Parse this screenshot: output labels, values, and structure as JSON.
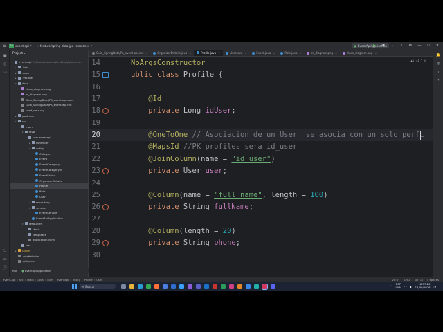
{
  "titlebar": {
    "project_badge": "EA",
    "project_name": "event-api",
    "branch": "feature/spring-data-jpa-relaciones",
    "run_config": "EventApiApplication"
  },
  "project_panel": {
    "title": "Project",
    "tree": [
      {
        "label": "event-api",
        "suffix": "C:\\Users\\Usuario\\Desktop\\Aplicacion",
        "depth": 0,
        "kind": "folder",
        "expanded": true
      },
      {
        "label": ".idea",
        "depth": 1,
        "kind": "folder"
      },
      {
        "label": ".mvn",
        "depth": 1,
        "kind": "folder"
      },
      {
        "label": ".vscode",
        "depth": 1,
        "kind": "folder"
      },
      {
        "label": "docs",
        "depth": 1,
        "kind": "folder",
        "expanded": true
      },
      {
        "label": "class_diagram.png",
        "depth": 2,
        "kind": "image"
      },
      {
        "label": "er_diagram.png",
        "depth": 2,
        "kind": "image"
      },
      {
        "label": "Guia_SpringDataJPA_event-api.docx",
        "depth": 2,
        "kind": "doc"
      },
      {
        "label": "Guia_SpringDataJPA_event-api.md",
        "depth": 2,
        "kind": "doc"
      },
      {
        "label": "seed_data.sql",
        "depth": 2,
        "kind": "doc"
      },
      {
        "label": "postman",
        "depth": 1,
        "kind": "folder"
      },
      {
        "label": "src",
        "depth": 1,
        "kind": "folder",
        "expanded": true
      },
      {
        "label": "main",
        "depth": 2,
        "kind": "folder",
        "expanded": true
      },
      {
        "label": "java",
        "depth": 3,
        "kind": "folder",
        "expanded": true
      },
      {
        "label": "com.eventapi",
        "depth": 4,
        "kind": "package",
        "expanded": true
      },
      {
        "label": "controller",
        "depth": 5,
        "kind": "package"
      },
      {
        "label": "entity",
        "depth": 5,
        "kind": "package",
        "expanded": true
      },
      {
        "label": "Category",
        "depth": 6,
        "kind": "class"
      },
      {
        "label": "Event",
        "depth": 6,
        "kind": "class"
      },
      {
        "label": "EventCategory",
        "depth": 6,
        "kind": "class"
      },
      {
        "label": "EventCategoryId",
        "depth": 6,
        "kind": "class"
      },
      {
        "label": "EventStatus",
        "depth": 6,
        "kind": "class"
      },
      {
        "label": "OrganizerDetails",
        "depth": 6,
        "kind": "class"
      },
      {
        "label": "Profile",
        "depth": 6,
        "kind": "class",
        "selected": true
      },
      {
        "label": "Role",
        "depth": 6,
        "kind": "class"
      },
      {
        "label": "User",
        "depth": 6,
        "kind": "class"
      },
      {
        "label": "repository",
        "depth": 5,
        "kind": "package"
      },
      {
        "label": "service",
        "depth": 5,
        "kind": "package",
        "expanded": true
      },
      {
        "label": "EventService",
        "depth": 6,
        "kind": "class"
      },
      {
        "label": "EventApiApplication",
        "depth": 5,
        "kind": "class"
      },
      {
        "label": "resources",
        "depth": 3,
        "kind": "folder",
        "expanded": true
      },
      {
        "label": "static",
        "depth": 4,
        "kind": "folder"
      },
      {
        "label": "templates",
        "depth": 4,
        "kind": "folder"
      },
      {
        "label": "application.yaml",
        "depth": 4,
        "kind": "doc"
      },
      {
        "label": "test",
        "depth": 2,
        "kind": "folder"
      },
      {
        "label": "target",
        "depth": 1,
        "kind": "target"
      },
      {
        "label": ".gitattributes",
        "depth": 1,
        "kind": "doc"
      },
      {
        "label": ".gitignore",
        "depth": 1,
        "kind": "doc"
      }
    ]
  },
  "tabs": [
    {
      "label": "Guia_SpringDataJPA_event-api.md",
      "color": "#7f8288"
    },
    {
      "label": "OrganizerDetails.java",
      "color": "#3d8fd1"
    },
    {
      "label": "Profile.java",
      "color": "#3d8fd1",
      "active": true
    },
    {
      "label": "User.java",
      "color": "#3d8fd1"
    },
    {
      "label": "Event.java",
      "color": "#3d8fd1"
    },
    {
      "label": "Role.java",
      "color": "#3d8fd1"
    },
    {
      "label": "er_diagram.png",
      "color": "#b07fd6"
    },
    {
      "label": "class_diagram.png",
      "color": "#b07fd6"
    }
  ],
  "editor": {
    "inspection_widget": "▲6 ✓1 ^ v",
    "lines": [
      {
        "n": "14",
        "tokens": [
          {
            "t": "NoArgsConstructor",
            "c": "ann"
          }
        ]
      },
      {
        "n": "15",
        "icon": "class",
        "tokens": [
          {
            "t": "ublic ",
            "c": "kw"
          },
          {
            "t": "class ",
            "c": "kw"
          },
          {
            "t": "Profile {",
            "c": ""
          }
        ]
      },
      {
        "n": "16",
        "tokens": []
      },
      {
        "n": "17",
        "tokens": [
          {
            "t": "    @Id",
            "c": "ann"
          }
        ]
      },
      {
        "n": "18",
        "icon": "field",
        "tokens": [
          {
            "t": "    private ",
            "c": "kw"
          },
          {
            "t": "Long ",
            "c": ""
          },
          {
            "t": "idUser",
            "c": "fld"
          },
          {
            "t": ";",
            "c": ""
          }
        ]
      },
      {
        "n": "19",
        "tokens": []
      },
      {
        "n": "20",
        "current": true,
        "tokens": [
          {
            "t": "    @OneToOne ",
            "c": "ann"
          },
          {
            "t": "// ",
            "c": "cmt"
          },
          {
            "t": "Asociacion",
            "c": "cmt u"
          },
          {
            "t": " de un User  se asocia con un solo perfi",
            "c": "cmt"
          }
        ]
      },
      {
        "n": "21",
        "tokens": [
          {
            "t": "    @MapsId ",
            "c": "ann"
          },
          {
            "t": "//PK profiles sera id_user",
            "c": "cmt"
          }
        ]
      },
      {
        "n": "22",
        "tokens": [
          {
            "t": "    @JoinColumn",
            "c": "ann"
          },
          {
            "t": "(name = ",
            "c": ""
          },
          {
            "t": "\"id_user\"",
            "c": "str u"
          },
          {
            "t": ")",
            "c": ""
          }
        ]
      },
      {
        "n": "23",
        "icon": "link",
        "tokens": [
          {
            "t": "    private ",
            "c": "kw"
          },
          {
            "t": "User ",
            "c": ""
          },
          {
            "t": "user",
            "c": "fld"
          },
          {
            "t": ";",
            "c": ""
          }
        ]
      },
      {
        "n": "24",
        "tokens": []
      },
      {
        "n": "25",
        "tokens": [
          {
            "t": "    @Column",
            "c": "ann"
          },
          {
            "t": "(name = ",
            "c": ""
          },
          {
            "t": "\"full_name\"",
            "c": "str u"
          },
          {
            "t": ", length = ",
            "c": ""
          },
          {
            "t": "100",
            "c": "num"
          },
          {
            "t": ")",
            "c": ""
          }
        ]
      },
      {
        "n": "26",
        "icon": "field",
        "tokens": [
          {
            "t": "    private ",
            "c": "kw"
          },
          {
            "t": "String ",
            "c": ""
          },
          {
            "t": "fullName",
            "c": "fld"
          },
          {
            "t": ";",
            "c": ""
          }
        ]
      },
      {
        "n": "27",
        "tokens": []
      },
      {
        "n": "28",
        "tokens": [
          {
            "t": "    @Column",
            "c": "ann"
          },
          {
            "t": "(length = ",
            "c": ""
          },
          {
            "t": "20",
            "c": "num"
          },
          {
            "t": ")",
            "c": ""
          }
        ]
      },
      {
        "n": "29",
        "icon": "field",
        "tokens": [
          {
            "t": "    private ",
            "c": "kw"
          },
          {
            "t": "String ",
            "c": ""
          },
          {
            "t": "phone",
            "c": "fld"
          },
          {
            "t": ";",
            "c": ""
          }
        ]
      },
      {
        "n": "30",
        "tokens": []
      }
    ]
  },
  "run_bar": {
    "run": "Run",
    "app": "EventApiApplication"
  },
  "status_bar": {
    "breadcrumb": [
      "event-api",
      "src",
      "main",
      "java",
      "com",
      "eventapi",
      "entity",
      "Profile",
      "user"
    ],
    "position": "20:57",
    "line_sep": "CRLF",
    "encoding": "UTF-8",
    "indent": "4 spaces"
  },
  "taskbar": {
    "search_placeholder": "Buscar",
    "lang": "ESP",
    "lang_sub": "LAA",
    "time": "18:57:20",
    "date": "14/06/2026"
  },
  "colors": {
    "accent": "#3574f0",
    "selection": "#3e4045",
    "keyword": "#cf8e6d",
    "annotation": "#b3ae60",
    "field": "#c77dbb",
    "string": "#6aab73",
    "number": "#2aacb8",
    "comment": "#7a7e85"
  }
}
